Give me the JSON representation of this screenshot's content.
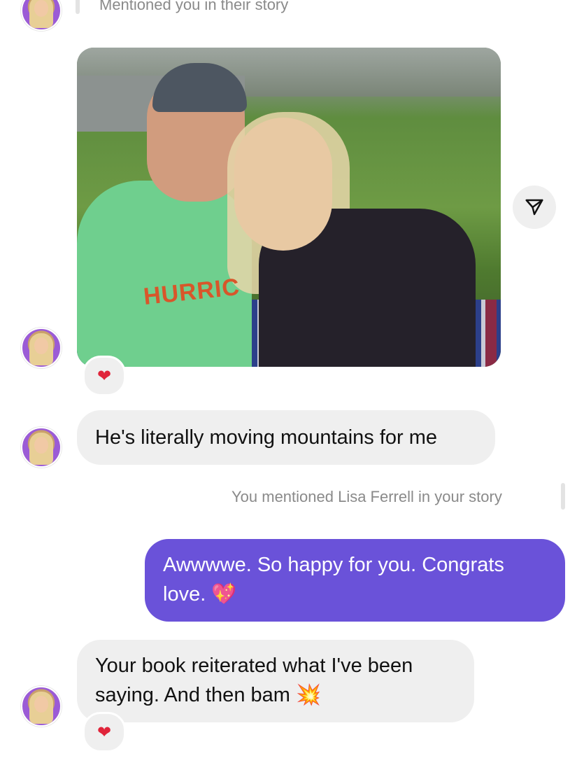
{
  "thread": {
    "story_mention_top": "Mentioned you in their story",
    "messages": [
      {
        "type": "story_reply_text",
        "text": "He's literally moving mountains for me"
      },
      {
        "type": "meta",
        "text": "You mentioned Lisa Ferrell in your story"
      },
      {
        "type": "outgoing",
        "text": "Awwwwe. So happy for you. Congrats love.",
        "emoji": "💖"
      },
      {
        "type": "incoming",
        "text": "Your book reiterated what I've been saying. And then bam",
        "emoji": "💥"
      }
    ],
    "reactions": {
      "photo_reaction": "❤",
      "last_reaction": "❤"
    },
    "photo": {
      "shirt_text": "HURRIC"
    }
  },
  "colors": {
    "incoming_bubble": "#efefef",
    "outgoing_bubble": "#6a52d9",
    "meta_text": "#8a8a8a",
    "reaction_heart": "#e0243a"
  },
  "icons": {
    "share": "send-plane-icon"
  }
}
